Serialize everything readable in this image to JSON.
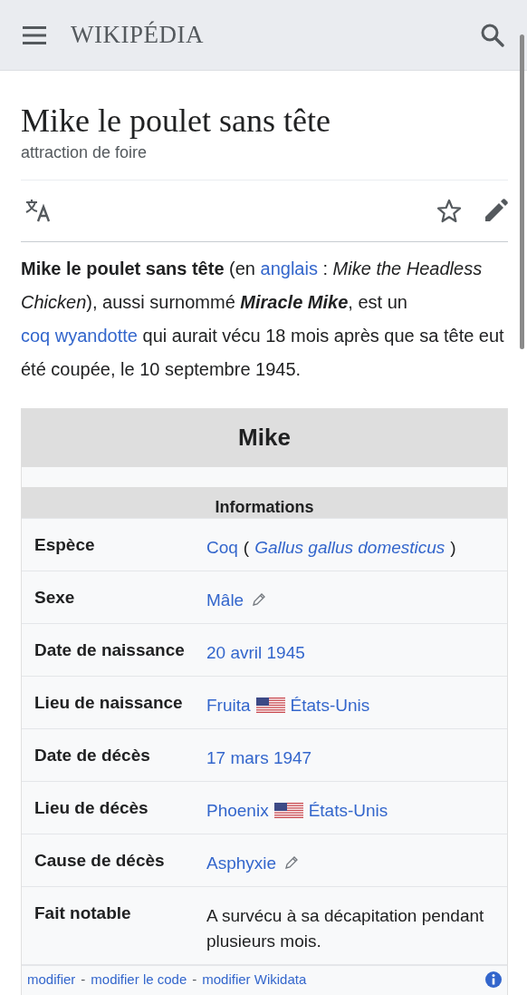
{
  "header": {
    "logo": "WIKIPÉDIA"
  },
  "article": {
    "title": "Mike le poulet sans tête",
    "subtitle": "attraction de foire"
  },
  "intro": [
    {
      "kind": "text",
      "text": "**Mike le poulet sans tête** (en "
    },
    {
      "kind": "link",
      "text": "anglais"
    },
    {
      "kind": "text",
      "text": " : *Mike the Headless Chicken*), aussi surnommé "
    },
    {
      "kind": "strong-italic",
      "text": "Miracle Mike"
    },
    {
      "kind": "text",
      "text": ", est un "
    },
    {
      "kind": "link",
      "text": "coq wyandotte"
    },
    {
      "kind": "text",
      "text": " qui aurait vécu 18 mois après que sa tête eut été coupée, le 10 septembre 1945."
    }
  ],
  "infobox": {
    "title": "Mike",
    "section": "Informations",
    "rows": [
      {
        "label": "Espèce",
        "parts": [
          {
            "kind": "link",
            "text": "Coq"
          },
          {
            "kind": "text",
            "text": "("
          },
          {
            "kind": "link",
            "text": "*Gallus gallus domesticus*"
          },
          {
            "kind": "text",
            "text": ")"
          }
        ]
      },
      {
        "label": "Sexe",
        "parts": [
          {
            "kind": "link",
            "text": "Mâle"
          },
          {
            "kind": "edit"
          }
        ]
      },
      {
        "label": "Date de naissance",
        "parts": [
          {
            "kind": "link",
            "text": "20 avril 1945"
          }
        ]
      },
      {
        "label": "Lieu de naissance",
        "parts": [
          {
            "kind": "link",
            "text": "Fruita"
          },
          {
            "kind": "flag"
          },
          {
            "kind": "link",
            "text": "États-Unis"
          }
        ]
      },
      {
        "label": "Date de décès",
        "parts": [
          {
            "kind": "link",
            "text": "17 mars 1947"
          }
        ]
      },
      {
        "label": "Lieu de décès",
        "parts": [
          {
            "kind": "link",
            "text": "Phoenix"
          },
          {
            "kind": "flag"
          },
          {
            "kind": "link",
            "text": "États-Unis"
          }
        ]
      },
      {
        "label": "Cause de décès",
        "parts": [
          {
            "kind": "link",
            "text": "Asphyxie"
          },
          {
            "kind": "edit"
          }
        ]
      },
      {
        "label": "Fait notable",
        "parts": [
          {
            "kind": "text",
            "text": "A survécu à sa décapitation pendant plusieurs mois."
          }
        ]
      }
    ],
    "footer": [
      "modifier",
      "-",
      "modifier le code",
      "-",
      "modifier Wikidata"
    ]
  }
}
